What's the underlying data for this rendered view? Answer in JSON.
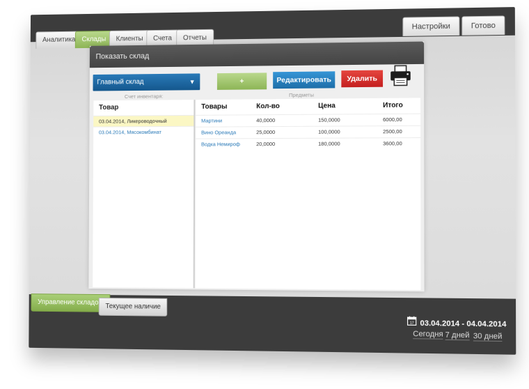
{
  "tabs": [
    {
      "label": "Аналитика",
      "active": false
    },
    {
      "label": "Склады",
      "active": true
    },
    {
      "label": "Клиенты",
      "active": false
    },
    {
      "label": "Счета",
      "active": false
    },
    {
      "label": "Отчеты",
      "active": false
    }
  ],
  "right_tabs": {
    "settings": "Настройки",
    "done": "Готово"
  },
  "panel": {
    "title": "Показать склад",
    "warehouse_select": "Главный склад",
    "add_button": "+",
    "edit_button": "Редактировать",
    "delete_button": "Удалить",
    "inventory_caption": "Счет инвентаря:",
    "items_caption": "Предметы"
  },
  "inventory": {
    "header": "Товар",
    "items": [
      "03.04.2014, Ликероводочный",
      "03.04.2014, Мясокомбинат"
    ]
  },
  "items_table": {
    "columns": [
      "Товары",
      "Кол-во",
      "Цена",
      "Итого"
    ],
    "rows": [
      [
        "Мартини",
        "40,0000",
        "150,0000",
        "6000,00"
      ],
      [
        "Вино Ореанда",
        "25,0000",
        "100,0000",
        "2500,00"
      ],
      [
        "Водка Немироф",
        "20,0000",
        "180,0000",
        "3600,00"
      ]
    ]
  },
  "bottom_tabs": {
    "manage": "Управление складом",
    "stock": "Текущее наличие"
  },
  "date_range": "03.04.2014 - 04.04.2014",
  "quick_ranges": {
    "today": "Сегодня",
    "week": "7 дней",
    "month": "30 дней"
  },
  "colors": {
    "accent_green": "#8db556",
    "blue": "#1e6ea8",
    "red": "#d62a2a",
    "dark": "#3c3c3c"
  }
}
